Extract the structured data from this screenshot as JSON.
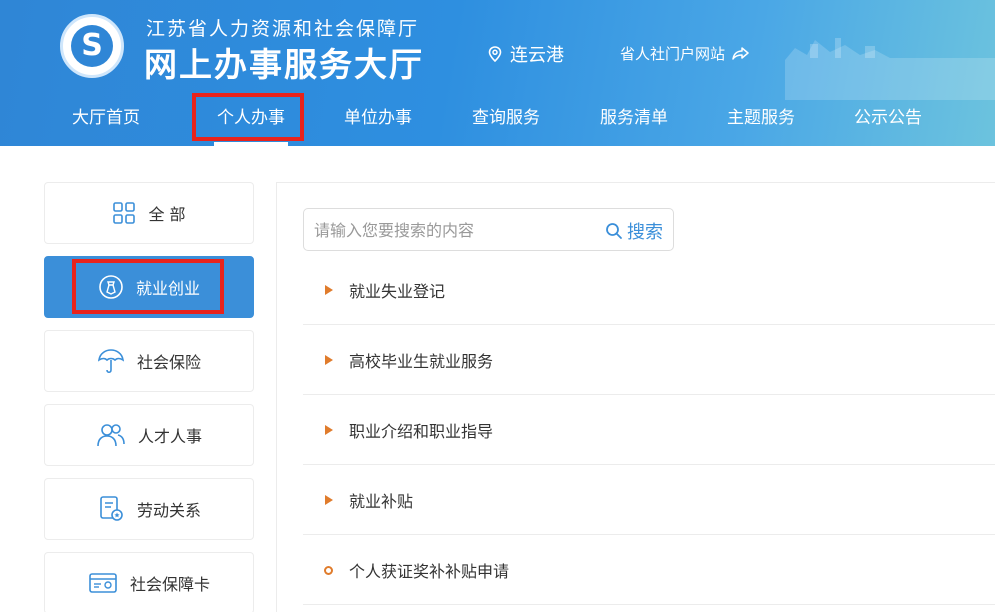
{
  "header": {
    "org_name": "江苏省人力资源和社会保障厅",
    "site_title": "网上办事服务大厅",
    "location": "连云港",
    "portal_link": "省人社门户网站",
    "colors": {
      "primary": "#2f86d6",
      "highlight": "#e8231c",
      "accent": "#e07c2c"
    }
  },
  "nav": {
    "items": [
      {
        "label": "大厅首页"
      },
      {
        "label": "个人办事",
        "active": true
      },
      {
        "label": "单位办事"
      },
      {
        "label": "查询服务"
      },
      {
        "label": "服务清单"
      },
      {
        "label": "主题服务"
      },
      {
        "label": "公示公告"
      }
    ]
  },
  "sidebar": {
    "items": [
      {
        "label": "全 部",
        "icon": "grid-icon"
      },
      {
        "label": "就业创业",
        "icon": "briefcase-icon",
        "active": true
      },
      {
        "label": "社会保险",
        "icon": "umbrella-icon"
      },
      {
        "label": "人才人事",
        "icon": "people-icon"
      },
      {
        "label": "劳动关系",
        "icon": "document-badge-icon"
      },
      {
        "label": "社会保障卡",
        "icon": "card-icon"
      }
    ]
  },
  "search": {
    "placeholder": "请输入您要搜索的内容",
    "button_label": "搜索"
  },
  "services": {
    "items": [
      {
        "label": "就业失业登记",
        "bullet": "triangle"
      },
      {
        "label": "高校毕业生就业服务",
        "bullet": "triangle"
      },
      {
        "label": "职业介绍和职业指导",
        "bullet": "triangle"
      },
      {
        "label": "就业补贴",
        "bullet": "triangle"
      },
      {
        "label": "个人获证奖补补贴申请",
        "bullet": "circle"
      }
    ]
  }
}
